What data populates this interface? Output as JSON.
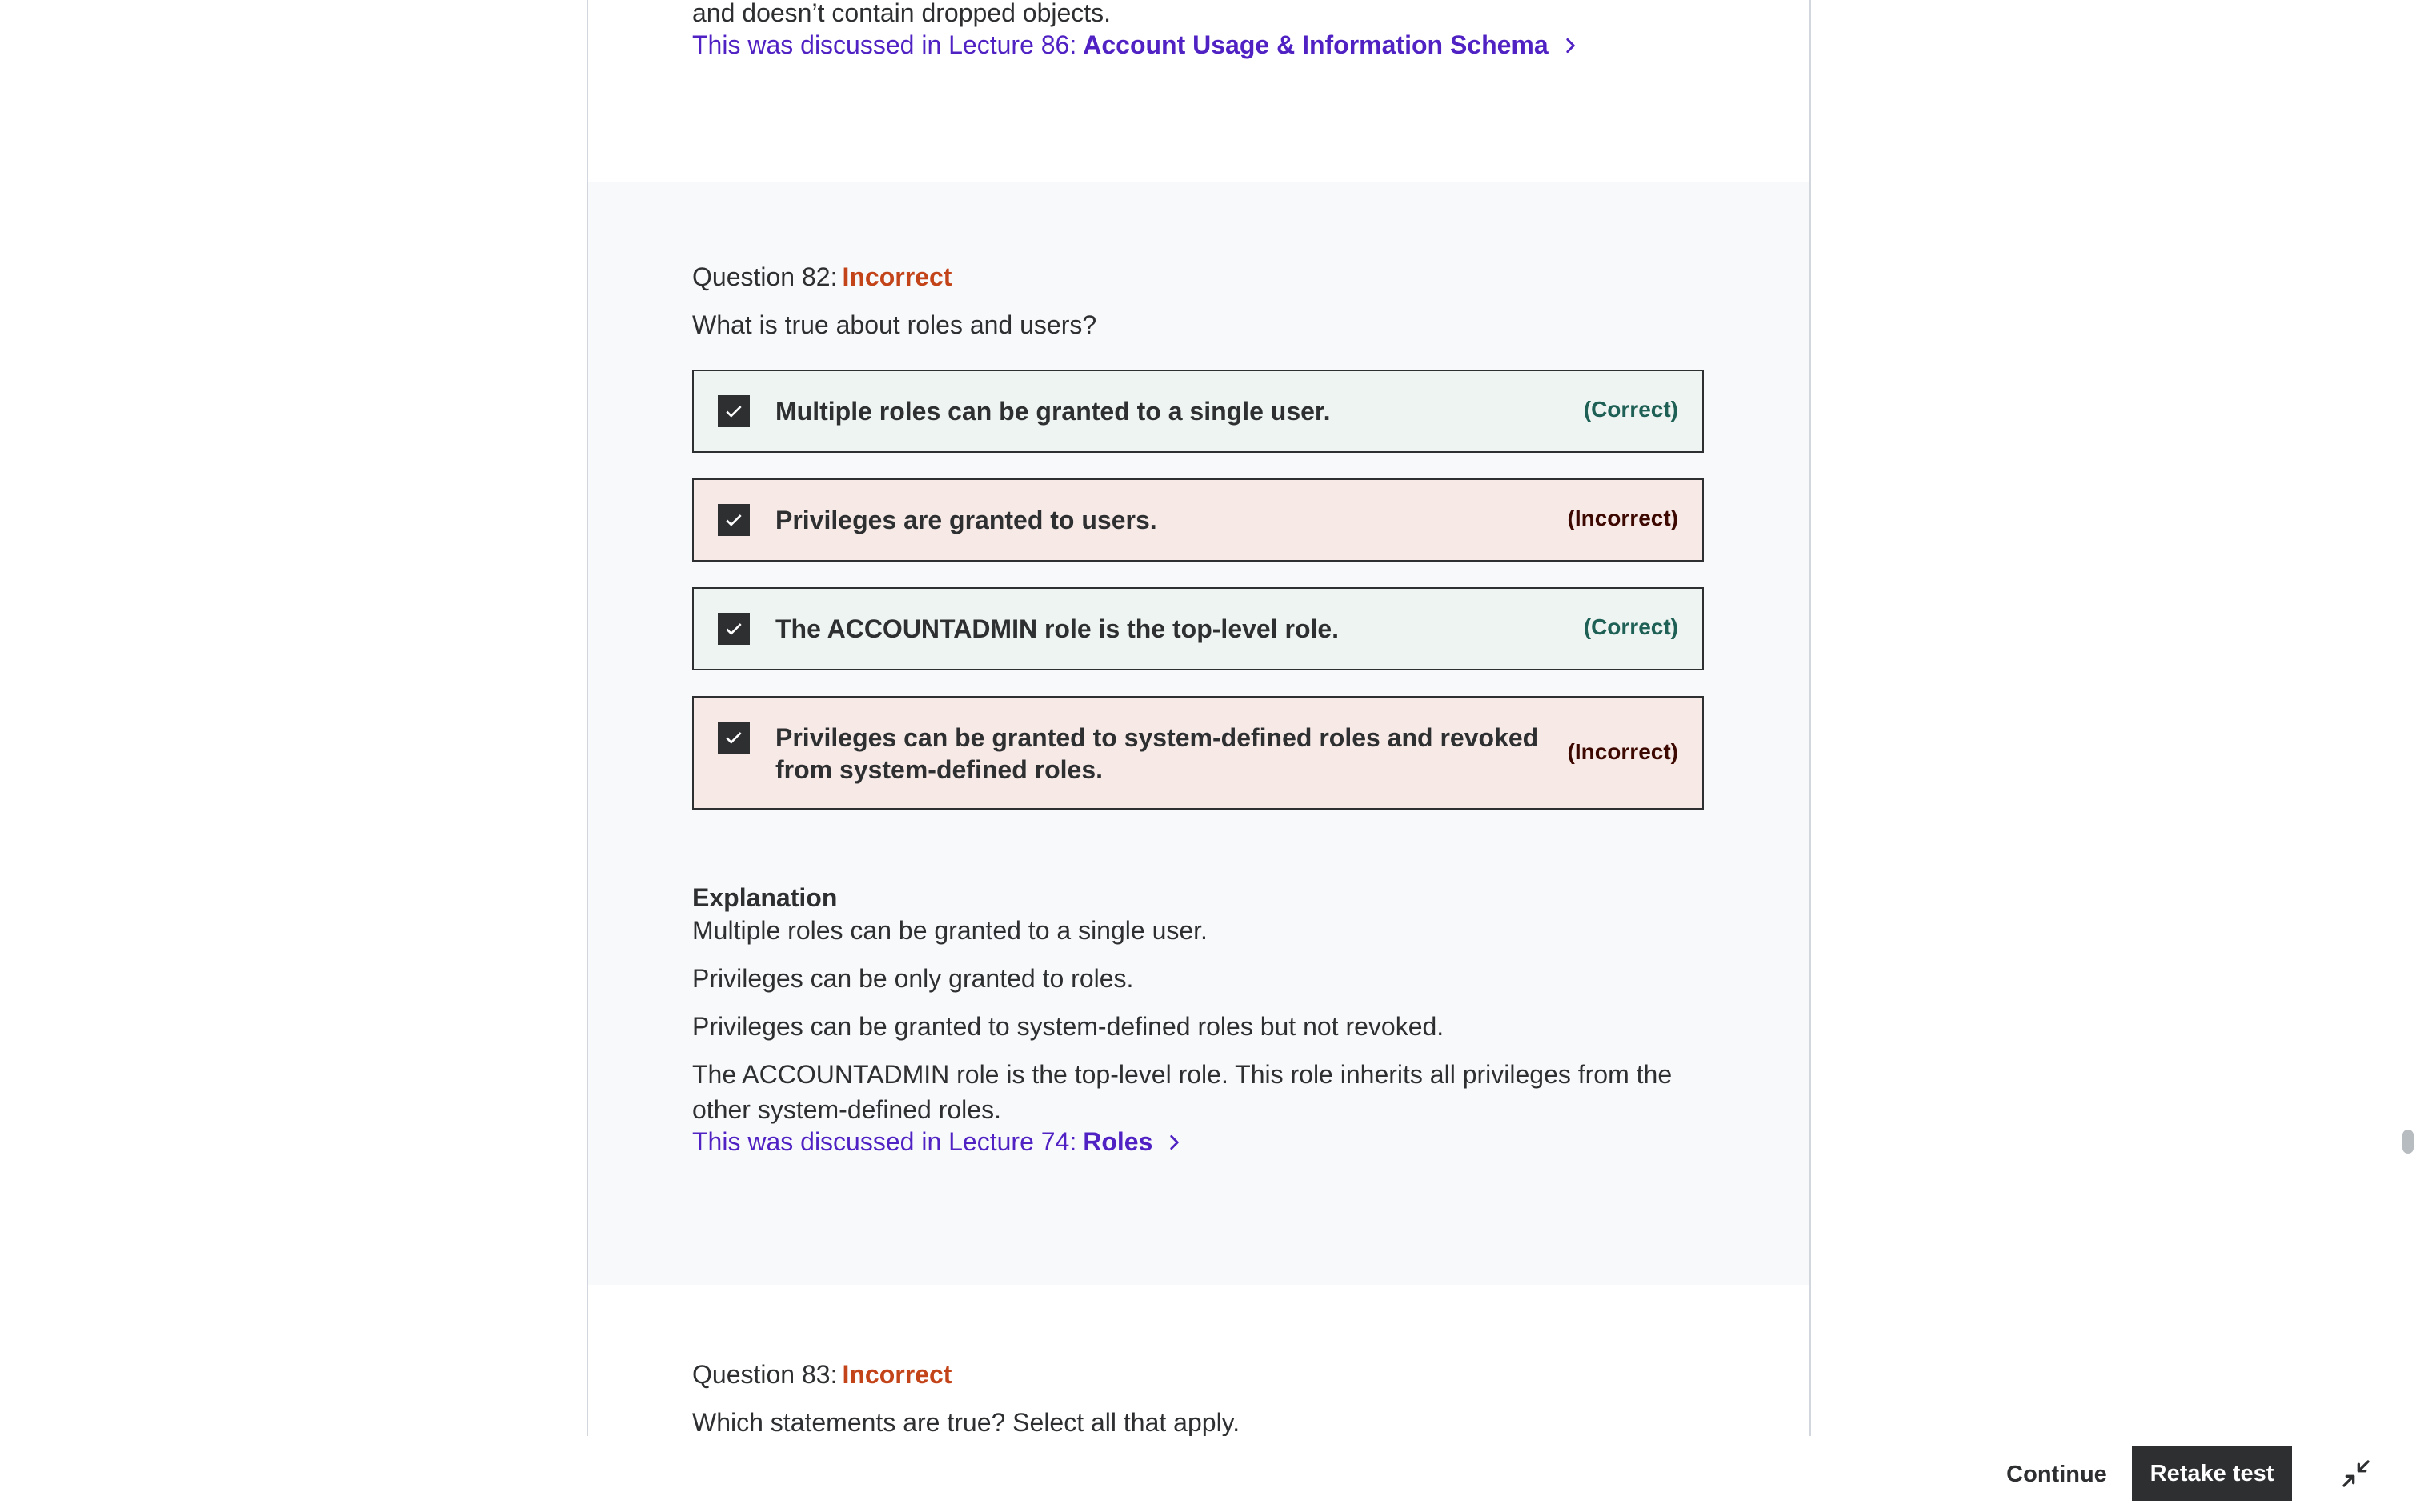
{
  "previous": {
    "text": "and doesn’t contain dropped objects.",
    "lecture_prefix": "This was discussed in Lecture 86:",
    "lecture_title": "Account Usage & Information Schema"
  },
  "q82": {
    "label": "Question 82:",
    "status": "Incorrect",
    "prompt": "What is true about roles and users?",
    "options": [
      {
        "text": "Multiple roles can be granted to a single user.",
        "tag": "(Correct)",
        "checked": true
      },
      {
        "text": "Privileges are granted to users.",
        "tag": "(Incorrect)",
        "checked": true
      },
      {
        "text": "The ACCOUNTADMIN role is the top-level role.",
        "tag": "(Correct)",
        "checked": true
      },
      {
        "text": "Privileges can be granted to system-defined roles and revoked from system-defined roles.",
        "tag": "(Incorrect)",
        "checked": true
      }
    ],
    "explanation_title": "Explanation",
    "explanation": [
      "Multiple roles can be granted to a single user.",
      "Privileges can be only granted to roles.",
      "Privileges can be granted to system-defined roles but not revoked.",
      "The ACCOUNTADMIN role is the top-level role. This role inherits all privileges from the other system-defined roles."
    ],
    "lecture_prefix": "This was discussed in Lecture 74:",
    "lecture_title": "Roles"
  },
  "q83": {
    "label": "Question 83:",
    "status": "Incorrect",
    "prompt": "Which statements are true? Select all that apply."
  },
  "footer": {
    "continue_label": "Continue",
    "retake_label": "Retake test"
  },
  "colors": {
    "link": "#5022c3",
    "incorrect_status": "#c4441a",
    "correct_tag": "#1e6055",
    "incorrect_tag": "#3d0800",
    "correct_bg": "#eef4f1",
    "incorrect_bg": "#f6e9e6",
    "dark": "#2d2f31"
  },
  "icons": {
    "checkbox": "checkmark-icon",
    "link_arrow": "chevron-right-icon",
    "exit_fullscreen": "collapse-arrows-icon"
  }
}
